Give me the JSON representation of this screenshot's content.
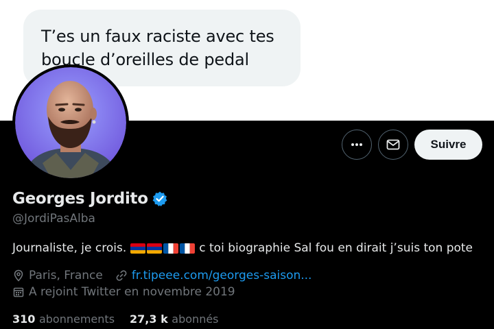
{
  "message": {
    "text": "T’es un faux raciste avec tes boucle d’oreilles de pedal"
  },
  "actions": {
    "more_icon": "more-dots-icon",
    "message_icon": "envelope-icon",
    "follow_label": "Suivre"
  },
  "profile": {
    "display_name": "Georges Jordito",
    "verified_icon": "verified-badge-icon",
    "handle": "@JordiPasAlba",
    "bio_before": "Journaliste, je crois.",
    "bio_flags": [
      "armenia-flag",
      "armenia-flag",
      "france-flag",
      "france-flag"
    ],
    "bio_after": "c toi biographie Sal fou en dirait j’suis ton pote",
    "location": "Paris, France",
    "website": "fr.tipeee.com/georges-saison...",
    "joined": "A rejoint Twitter en novembre 2019"
  },
  "stats": {
    "following_count": "310",
    "following_label": "abonnements",
    "followers_count": "27,3 k",
    "followers_label": "abonnés"
  },
  "colors": {
    "accent": "#1d9bf0",
    "background": "#000000",
    "text": "#e7e9ea",
    "muted": "#71767b",
    "bubble": "#eff3f4"
  }
}
